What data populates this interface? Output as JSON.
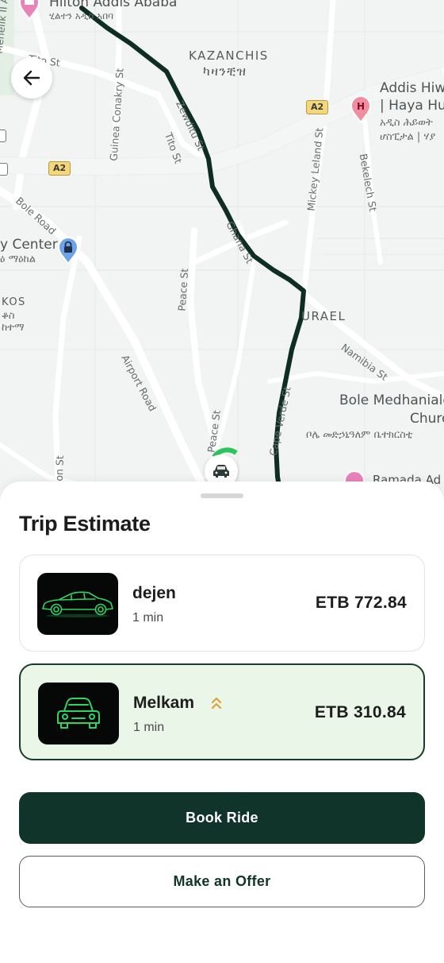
{
  "map": {
    "areas": {
      "kazanchis_en": "KAZANCHIS",
      "kazanchis_am": "ካዛንቺዝ",
      "urael": "URAEL",
      "kos_en": "KOS",
      "kos_am1": "ቆስ",
      "kos_am2": "ከተማ"
    },
    "pois": {
      "hilton_en": "Hilton Addis Ababa",
      "hilton_am": "ሂልተን አዲስ አበባ",
      "addis_hiwot_en1": "Addis Hiw",
      "addis_hiwot_en2": "| Haya Hul",
      "addis_hiwot_am1": "አዲስ ሕይወት",
      "addis_hiwot_am2": "ሆስፒታል | ሃያ",
      "center_en": "y Center",
      "center_am": "ዕ ማዕከል",
      "bole_medhaniale_en1": "Bole Medhaniale",
      "bole_medhaniale_en2": "Churc",
      "bole_medhaniale_am": "ቦሌ መድኃኒዓለም ቤተክርስቲ",
      "ramada": "Ramada Ad"
    },
    "streets": {
      "tito_st_top": "Tito St",
      "tito_st_mid": "Tito St",
      "guinea_conakry": "Guinea Conakry St",
      "zewditu": "Zewditu St",
      "ghana": "Ghana St",
      "mickey_leland": "Mickey Leland St",
      "bekelech": "Bekelech St",
      "bole_road": "Bole Road",
      "peace_st": "Peace St",
      "peace_st_2": "Peace St",
      "airport_road": "Airport Road",
      "namibia": "Namibia St",
      "cape_verde": "Cape Verde St",
      "menelik": "Menelik II Ave",
      "bon_st": "bon St"
    },
    "road_badges": [
      "A2",
      "A2"
    ]
  },
  "sheet": {
    "title": "Trip Estimate",
    "rides": [
      {
        "name": "dejen",
        "eta": "1 min",
        "price": "ETB 772.84",
        "selected": false,
        "icon": "sedan-icon"
      },
      {
        "name": "Melkam",
        "eta": "1 min",
        "price": "ETB 310.84",
        "selected": true,
        "icon": "car-front-icon",
        "badge_icon": "double-chevron-up-icon"
      }
    ],
    "book_label": "Book Ride",
    "offer_label": "Make an Offer"
  },
  "colors": {
    "primary": "#10342a",
    "route": "#0f2e23",
    "selected_bg": "#e9f6e8",
    "neon_green": "#2bd463",
    "boost_orange": "#e0a03a",
    "hospital_pin": "#f08ea0",
    "lock_pin": "#6fa3e8"
  }
}
